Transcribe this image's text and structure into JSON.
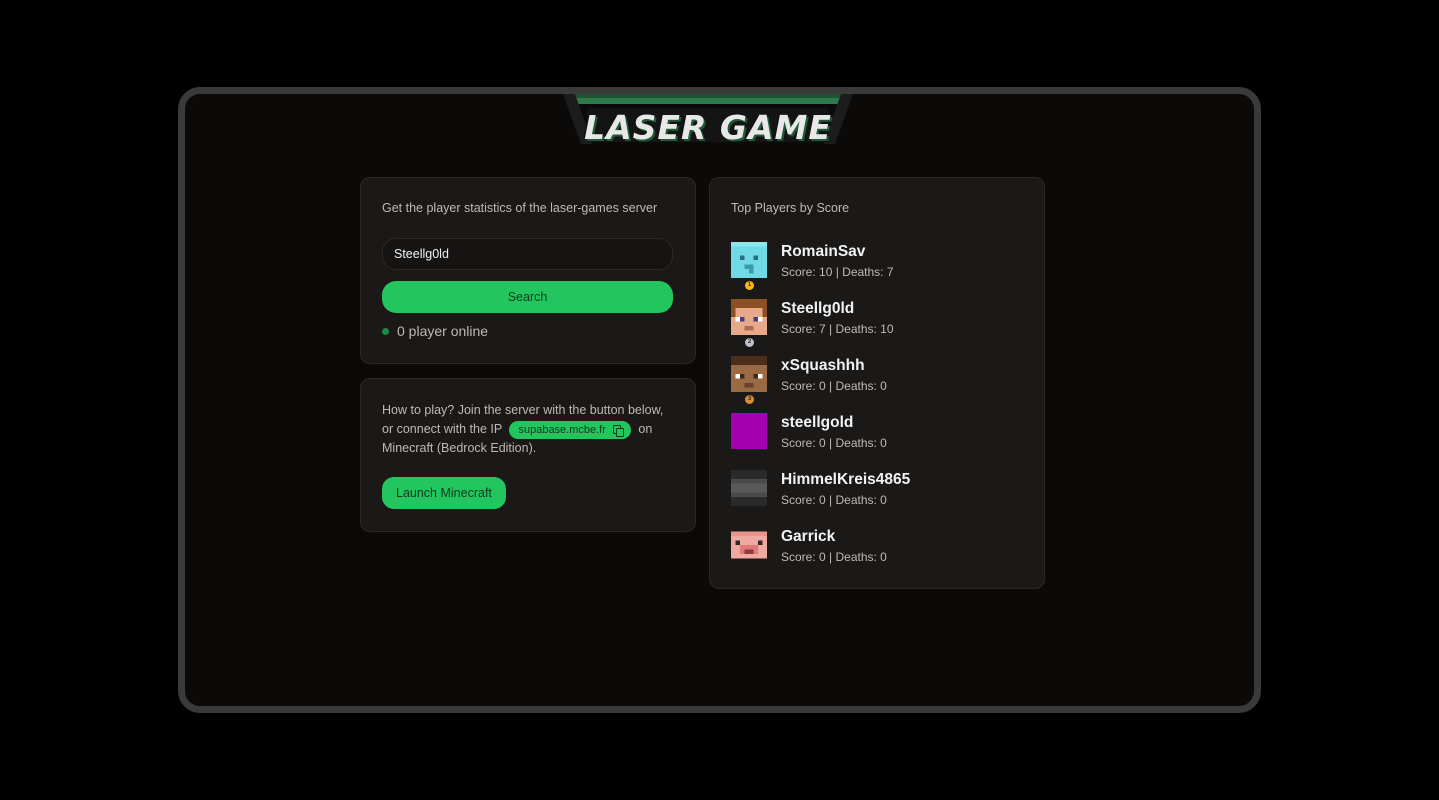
{
  "logo": {
    "text": "LASER GAME"
  },
  "search_card": {
    "description": "Get the player statistics of the laser-games server",
    "input_value": "Steellg0ld",
    "button_label": "Search",
    "online_text": "0 player online"
  },
  "howto_card": {
    "text_before": "How to play? Join the server with the button below, or connect with the IP",
    "ip": "supabase.mcbe.fr",
    "text_after": "on Minecraft (Bedrock Edition).",
    "button_label": "Launch Minecraft"
  },
  "leaderboard": {
    "title": "Top Players by Score",
    "players": [
      {
        "name": "RomainSav",
        "stats": "Score: 10 | Deaths: 7",
        "rank": "1",
        "rank_color": "#f5b81c",
        "avatar": "diamond-face-icon"
      },
      {
        "name": "Steellg0ld",
        "stats": "Score: 7 | Deaths: 10",
        "rank": "2",
        "rank_color": "#b9c3d4",
        "avatar": "steve-face-icon"
      },
      {
        "name": "xSquashhh",
        "stats": "Score: 0 | Deaths: 0",
        "rank": "3",
        "rank_color": "#d98b3a",
        "avatar": "brown-face-icon"
      },
      {
        "name": "steellgold",
        "stats": "Score: 0 | Deaths: 0",
        "rank": "",
        "rank_color": "",
        "avatar": "purple-face-icon"
      },
      {
        "name": "HimmelKreis4865",
        "stats": "Score: 0 | Deaths: 0",
        "rank": "",
        "rank_color": "",
        "avatar": "gray-face-icon"
      },
      {
        "name": "Garrick",
        "stats": "Score: 0 | Deaths: 0",
        "rank": "",
        "rank_color": "",
        "avatar": "pig-face-icon"
      }
    ]
  }
}
